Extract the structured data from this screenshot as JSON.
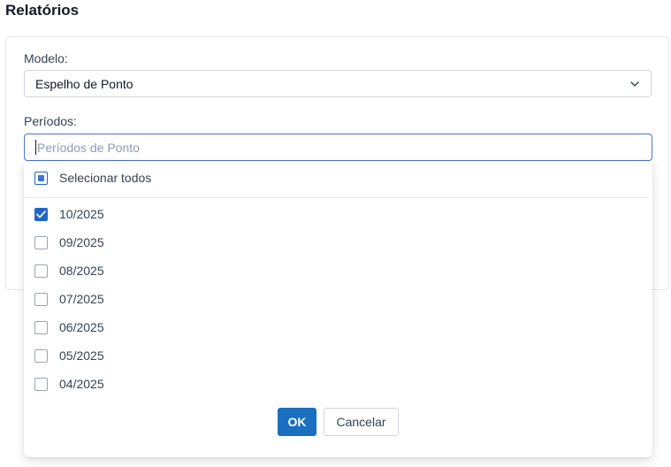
{
  "page": {
    "title": "Relatórios"
  },
  "form": {
    "modelo": {
      "label": "Modelo:",
      "value": "Espelho de Ponto"
    },
    "periodos": {
      "label": "Períodos:",
      "placeholder": "Períodos de Ponto",
      "value": ""
    }
  },
  "dropdown": {
    "select_all": {
      "label": "Selecionar todos",
      "state": "indeterminate"
    },
    "options": [
      {
        "label": "10/2025",
        "checked": true
      },
      {
        "label": "09/2025",
        "checked": false
      },
      {
        "label": "08/2025",
        "checked": false
      },
      {
        "label": "07/2025",
        "checked": false
      },
      {
        "label": "06/2025",
        "checked": false
      },
      {
        "label": "05/2025",
        "checked": false
      },
      {
        "label": "04/2025",
        "checked": false
      }
    ],
    "ok_label": "OK",
    "cancel_label": "Cancelar"
  },
  "icons": {
    "select_chevron": "chevron-down-icon",
    "check": "check-icon"
  },
  "colors": {
    "primary": "#1a6fbf",
    "checkbox_checked": "#1f66c8",
    "focus_border": "#4b74c9"
  }
}
